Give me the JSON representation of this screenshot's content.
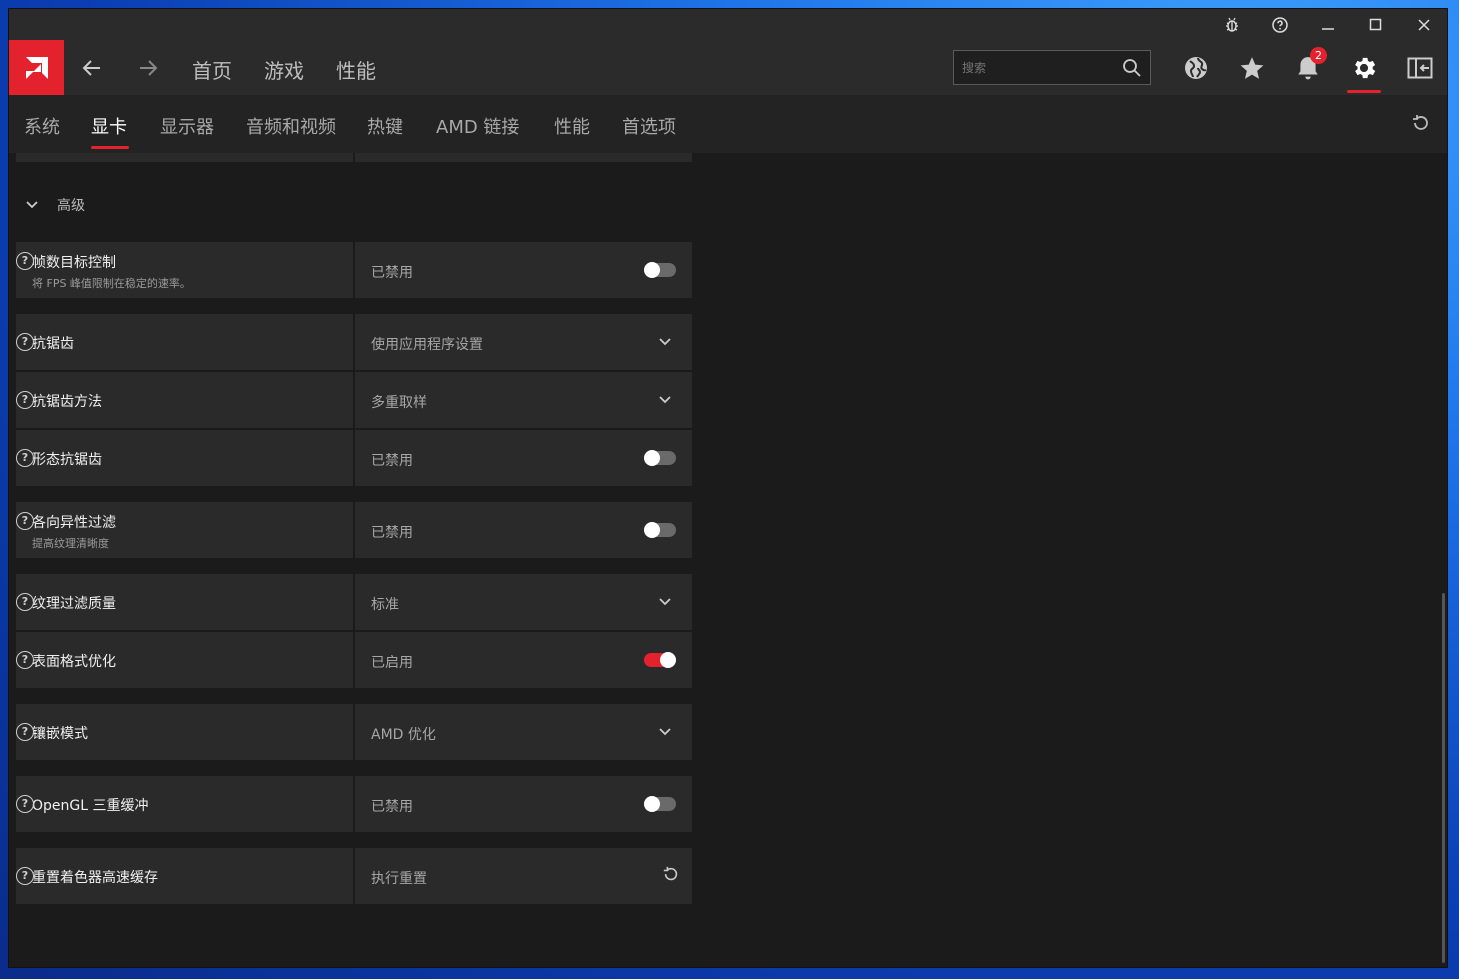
{
  "titlebar": {
    "icons": [
      "bug-icon",
      "help-icon",
      "minimize-icon",
      "maximize-icon",
      "close-icon"
    ]
  },
  "nav": {
    "links": [
      "首页",
      "游戏",
      "性能"
    ],
    "search_placeholder": "搜索",
    "notification_count": "2",
    "icons": [
      "globe-icon",
      "star-icon",
      "bell-icon",
      "gear-icon",
      "sidebar-icon"
    ]
  },
  "tabs": [
    "系统",
    "显卡",
    "显示器",
    "音频和视频",
    "热键",
    "AMD 链接",
    "性能",
    "首选项"
  ],
  "active_tab": "显卡",
  "advanced": {
    "label": "高级"
  },
  "settings": [
    {
      "name": "帧数目标控制",
      "sub": "将 FPS 峰值限制在稳定的速率。",
      "value": "已禁用",
      "control": "toggle",
      "on": false
    },
    {
      "name": "抗锯齿",
      "sub": "",
      "value": "使用应用程序设置",
      "control": "dropdown"
    },
    {
      "name": "抗锯齿方法",
      "sub": "",
      "value": "多重取样",
      "control": "dropdown"
    },
    {
      "name": "形态抗锯齿",
      "sub": "",
      "value": "已禁用",
      "control": "toggle",
      "on": false
    },
    {
      "name": "各向异性过滤",
      "sub": "提高纹理清晰度",
      "value": "已禁用",
      "control": "toggle",
      "on": false
    },
    {
      "name": "纹理过滤质量",
      "sub": "",
      "value": "标准",
      "control": "dropdown"
    },
    {
      "name": "表面格式优化",
      "sub": "",
      "value": "已启用",
      "control": "toggle",
      "on": true
    },
    {
      "name": "镶嵌模式",
      "sub": "",
      "value": "AMD 优化",
      "control": "dropdown"
    },
    {
      "name": "OpenGL 三重缓冲",
      "sub": "",
      "value": "已禁用",
      "control": "toggle",
      "on": false
    },
    {
      "name": "重置着色器高速缓存",
      "sub": "",
      "value": "执行重置",
      "control": "reset"
    }
  ],
  "colors": {
    "accent": "#e4222e",
    "panel": "#2a2a2a",
    "bg": "#1b1b1b"
  }
}
